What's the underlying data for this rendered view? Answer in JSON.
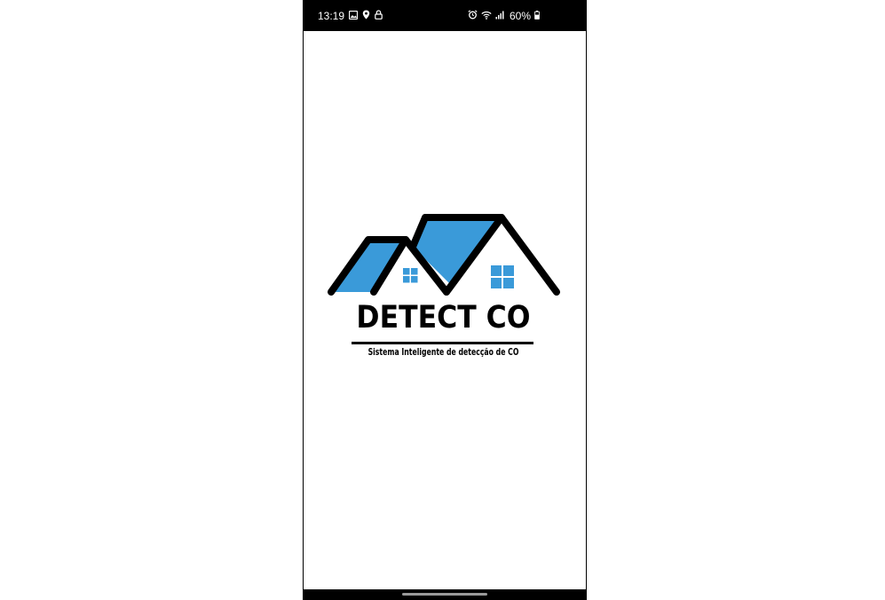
{
  "status_bar": {
    "time": "13:19",
    "battery_percent": "60%",
    "left_icons": [
      "gallery-icon",
      "location-icon",
      "lock-icon"
    ],
    "right_icons": [
      "alarm-icon",
      "wifi-icon",
      "signal-icon",
      "battery-icon"
    ]
  },
  "splash": {
    "app_name": "DETECT CO",
    "tagline": "Sistema Inteligente de detecção de CO",
    "logo_icon": "house-roof-icon"
  },
  "colors": {
    "roof_blue": "#3a9ad9",
    "outline": "#000000",
    "status_bar_bg": "#000000",
    "background": "#ffffff"
  }
}
